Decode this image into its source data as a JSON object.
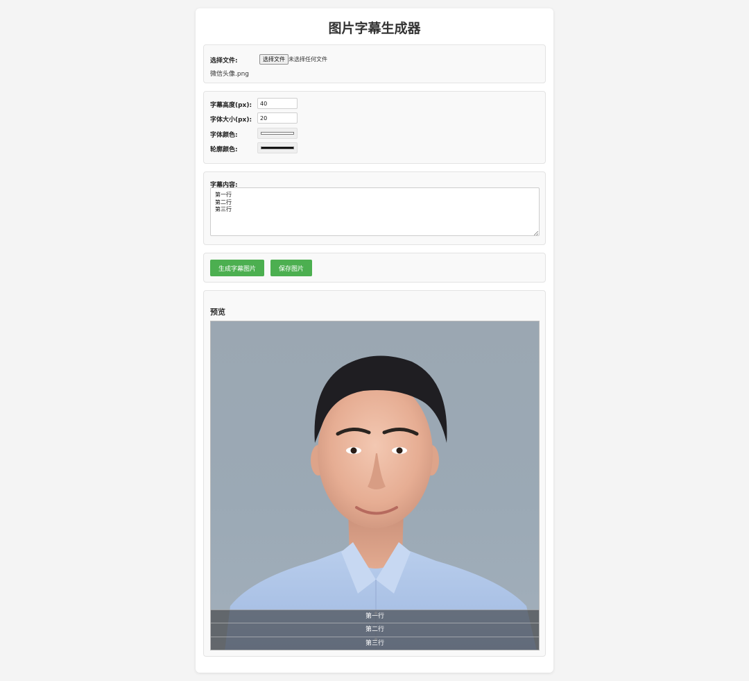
{
  "page": {
    "title": "图片字幕生成器"
  },
  "file_section": {
    "label": "选择文件:",
    "button_label": "选择文件",
    "status_text": "未选择任何文件",
    "selected_file_name": "微信头像.png"
  },
  "settings": {
    "caption_height": {
      "label": "字幕高度(px):",
      "value": "40"
    },
    "font_size": {
      "label": "字体大小(px):",
      "value": "20"
    },
    "font_color": {
      "label": "字体颜色:",
      "value": "#ffffff"
    },
    "outline_color": {
      "label": "轮廓颜色:",
      "value": "#000000"
    }
  },
  "content": {
    "label": "字幕内容:",
    "lines": [
      "第一行",
      "第二行",
      "第三行"
    ]
  },
  "actions": {
    "generate_label": "生成字幕图片",
    "save_label": "保存图片"
  },
  "preview": {
    "label": "预览",
    "captions": [
      "第一行",
      "第二行",
      "第三行"
    ]
  },
  "colors": {
    "accent": "#4caf50",
    "page_background": "#f4f4f4",
    "caption_bar": "#3c3c3c"
  }
}
